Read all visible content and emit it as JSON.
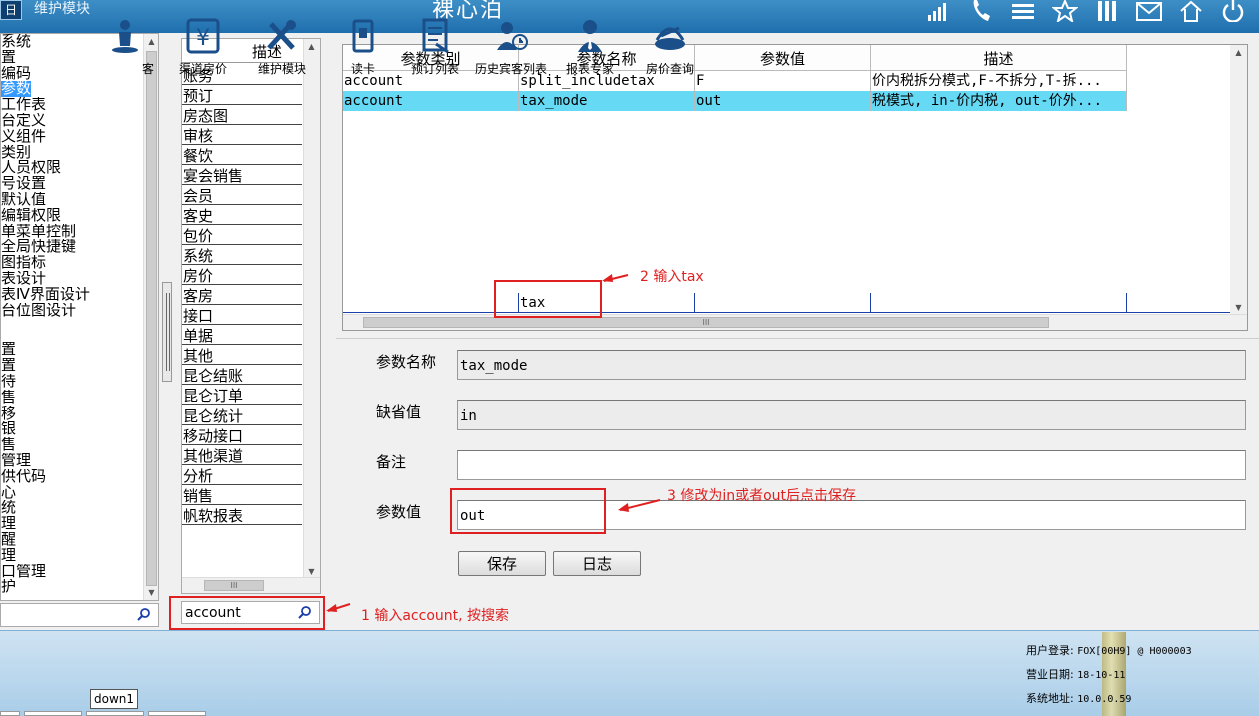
{
  "titlebar": {
    "app_icon": "日",
    "app_name": "维护模块",
    "center_title": "裸心泊",
    "icons": [
      "signal-icon",
      "phone-icon",
      "menu-icon",
      "star-icon",
      "pause-icon",
      "mail-icon",
      "home-icon",
      "power-icon"
    ]
  },
  "tree": {
    "items": [
      {
        "label": "系统"
      },
      {
        "label": "置"
      },
      {
        "label": "编码"
      },
      {
        "label": "参数",
        "selected": true
      },
      {
        "label": "工作表"
      },
      {
        "label": "台定义"
      },
      {
        "label": "义组件"
      },
      {
        "label": "类别"
      },
      {
        "label": "人员权限"
      },
      {
        "label": "号设置"
      },
      {
        "label": "默认值"
      },
      {
        "label": "编辑权限"
      },
      {
        "label": "单菜单控制"
      },
      {
        "label": "全局快捷键"
      },
      {
        "label": "图指标"
      },
      {
        "label": "表设计"
      },
      {
        "label": "表Ⅳ界面设计"
      },
      {
        "label": "台位图设计"
      }
    ],
    "items2": [
      {
        "label": "置"
      },
      {
        "label": "置"
      },
      {
        "label": "待"
      },
      {
        "label": "售"
      },
      {
        "label": "移"
      },
      {
        "label": "银"
      },
      {
        "label": "售"
      },
      {
        "label": "管理"
      },
      {
        "label": "供代码"
      },
      {
        "label": "心"
      },
      {
        "label": "统"
      },
      {
        "label": "理"
      },
      {
        "label": "醒"
      },
      {
        "label": "理"
      },
      {
        "label": "口管理"
      },
      {
        "label": "护"
      }
    ]
  },
  "categories": {
    "header": "描述",
    "items": [
      "账务",
      "预订",
      "房态图",
      "审核",
      "餐饮",
      "宴会销售",
      "会员",
      "客史",
      "包价",
      "系统",
      "房价",
      "客房",
      "接口",
      "单据",
      "其他",
      "昆仑结账",
      "昆仑订单",
      "昆仑统计",
      "移动接口",
      "其他渠道",
      "分析",
      "销售",
      "帆软报表"
    ],
    "search_value": "account"
  },
  "grid": {
    "columns": [
      "参数类别",
      "参数名称",
      "参数值",
      "描述"
    ],
    "rows": [
      {
        "cells": [
          "account",
          "split_includetax",
          "F",
          "价内税拆分模式,F-不拆分,T-拆..."
        ],
        "selected": false
      },
      {
        "cells": [
          "account",
          "tax_mode",
          "out",
          "税模式, in-价内税, out-价外..."
        ],
        "selected": true
      }
    ],
    "edit_row": [
      "",
      "tax",
      "",
      ""
    ]
  },
  "form": {
    "name_label": "参数名称",
    "name_value": "tax_mode",
    "default_label": "缺省值",
    "default_value": "in",
    "remark_label": "备注",
    "remark_value": "",
    "value_label": "参数值",
    "value_value": "out",
    "save_label": "保存",
    "log_label": "日志"
  },
  "annotations": {
    "step1": "1 输入account, 按搜索",
    "step2": "2 输入tax",
    "step3": "3 修改为in或者out后点击保存"
  },
  "bottombar": {
    "buttons": [
      {
        "label": "客",
        "icon": "person-icon"
      },
      {
        "label": "渠道房价",
        "icon": "yen-icon"
      },
      {
        "label": "维护模块",
        "icon": "tools-icon"
      },
      {
        "label": "读卡",
        "icon": "card-icon"
      },
      {
        "label": "预订列表",
        "icon": "list-icon"
      },
      {
        "label": "历史宾客列表",
        "icon": "history-icon"
      },
      {
        "label": "报表专家",
        "icon": "expert-icon"
      },
      {
        "label": "房价查询",
        "icon": "rate-icon"
      }
    ],
    "tooltip": "down1",
    "status": {
      "user_label": "用户登录:",
      "user_value": "FOX[00H9] @ H000003",
      "date_label": "营业日期:",
      "date_value": "18-10-11",
      "addr_label": "系统地址:",
      "addr_value": "10.0.0.59"
    }
  },
  "colors": {
    "title_bar": "#2a7fbd",
    "selected_row": "#66d9f5",
    "annotation_red": "#e02020"
  }
}
